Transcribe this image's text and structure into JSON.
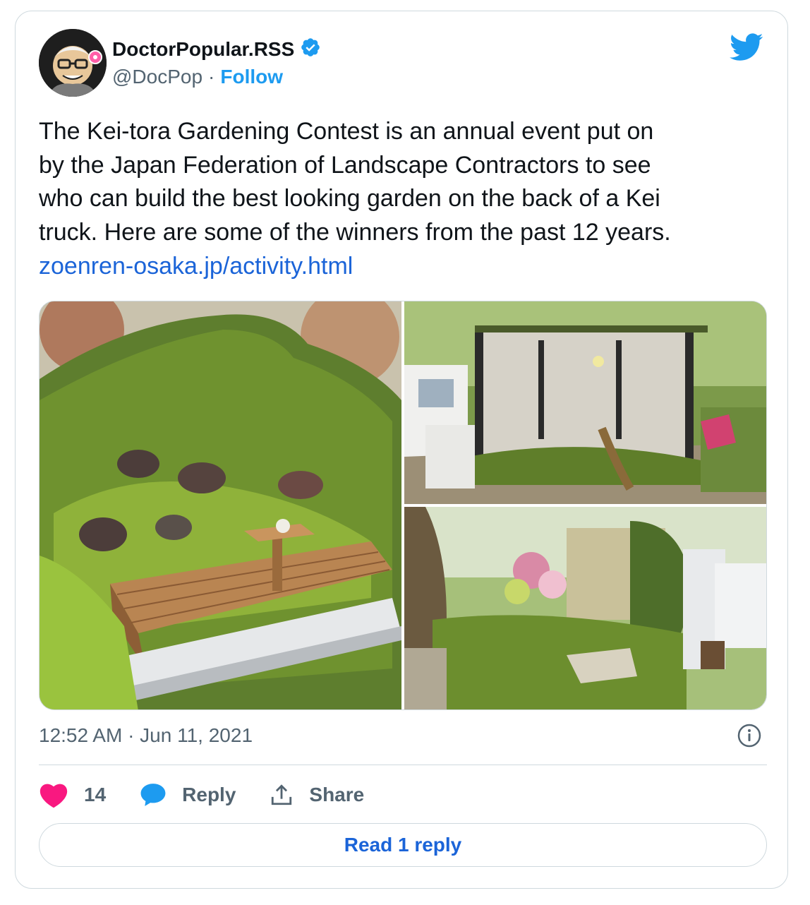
{
  "author": {
    "display_name": "DoctorPopular.RSS",
    "handle": "@DocPop",
    "separator": "·",
    "follow_label": "Follow",
    "verified": true
  },
  "tweet": {
    "text": "The Kei-tora Gardening Contest is an annual event put on\nby the Japan Federation of Landscape Contractors to see\nwho can build the best looking garden on the back of a Kei\ntruck. Here are some of the winners from the past 12 years.",
    "link": "zoenren-osaka.jp/activity.html",
    "timestamp": "12:52 AM · Jun 11, 2021"
  },
  "actions": {
    "likes_count": "14",
    "reply_label": "Reply",
    "share_label": "Share"
  },
  "read_replies_label": "Read 1 reply",
  "colors": {
    "accent": "#1d9bf0",
    "link": "#1b64d8",
    "like": "#f91880",
    "text": "#0f1419",
    "muted": "#536471",
    "border": "#cfd9de"
  },
  "icons": [
    "verified-badge-icon",
    "twitter-bird-icon",
    "info-icon",
    "heart-icon",
    "reply-bubble-icon",
    "share-icon"
  ]
}
